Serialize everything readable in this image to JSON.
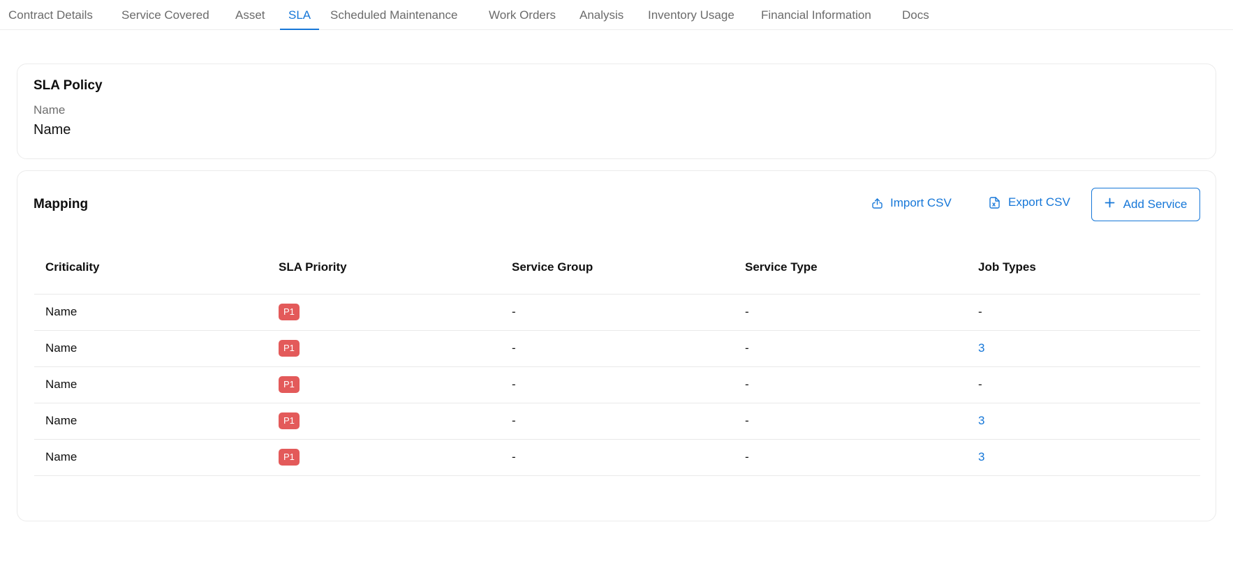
{
  "tabs": [
    {
      "label": "Contract Details"
    },
    {
      "label": "Service Covered"
    },
    {
      "label": "Asset"
    },
    {
      "label": "SLA"
    },
    {
      "label": "Scheduled Maintenance"
    },
    {
      "label": "Work Orders"
    },
    {
      "label": "Analysis"
    },
    {
      "label": "Inventory Usage"
    },
    {
      "label": "Financial Information"
    },
    {
      "label": "Docs"
    }
  ],
  "active_tab": "SLA",
  "sla_policy": {
    "title": "SLA Policy",
    "name_label": "Name",
    "name_value": "Name"
  },
  "mapping": {
    "title": "Mapping",
    "import_label": "Import CSV",
    "export_label": "Export CSV",
    "add_label": "Add Service",
    "columns": [
      "Criticality",
      "SLA Priority",
      "Service Group",
      "Service Type",
      "Job Types"
    ],
    "rows": [
      {
        "criticality": "Name",
        "priority": "P1",
        "service_group": "-",
        "service_type": "-",
        "job_types": "-"
      },
      {
        "criticality": "Name",
        "priority": "P1",
        "service_group": "-",
        "service_type": "-",
        "job_types": "3"
      },
      {
        "criticality": "Name",
        "priority": "P1",
        "service_group": "-",
        "service_type": "-",
        "job_types": "-"
      },
      {
        "criticality": "Name",
        "priority": "P1",
        "service_group": "-",
        "service_type": "-",
        "job_types": "3"
      },
      {
        "criticality": "Name",
        "priority": "P1",
        "service_group": "-",
        "service_type": "-",
        "job_types": "3"
      }
    ]
  },
  "colors": {
    "accent": "#1677d8",
    "priority_badge": "#e35a5a",
    "border": "#ebebeb"
  },
  "icons": {
    "import": "upload-icon",
    "export": "file-export-icon",
    "add": "plus-icon"
  }
}
